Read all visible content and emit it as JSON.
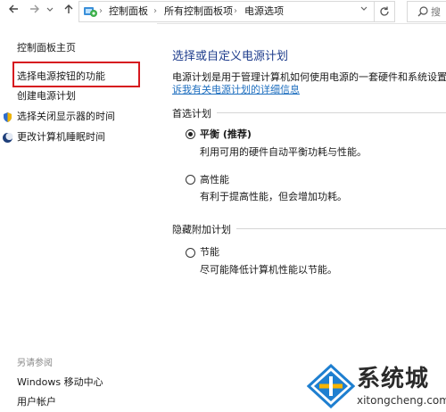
{
  "address_bar": {
    "crumbs": [
      "控制面板",
      "所有控制面板项",
      "电源选项"
    ],
    "search_placeholder": "搜"
  },
  "icons": {
    "back": "back-arrow-icon",
    "forward": "forward-arrow-icon",
    "recent": "chevron-down-icon",
    "up": "up-arrow-icon",
    "control_panel": "control-panel-icon",
    "refresh": "refresh-icon",
    "search": "search-icon",
    "shield": "uac-shield-icon",
    "moon": "sleep-moon-icon"
  },
  "sidebar": {
    "home": "控制面板主页",
    "items": [
      {
        "label": "选择电源按钮的功能",
        "highlighted": true
      },
      {
        "label": "创建电源计划"
      },
      {
        "label": "选择关闭显示器的时间",
        "icon": "uac-shield-icon"
      },
      {
        "label": "更改计算机睡眠时间",
        "icon": "sleep-moon-icon"
      }
    ],
    "see_also_title": "另请参阅",
    "see_also": [
      "Windows 移动中心",
      "用户帐户"
    ]
  },
  "main": {
    "title": "选择或自定义电源计划",
    "description": "电源计划是用于管理计算机如何使用电源的一套硬件和系统设置(",
    "more_link": "诉我有关电源计划的详细信息",
    "preferred_label": "首选计划",
    "hidden_label": "隐藏附加计划",
    "plans": [
      {
        "name": "平衡 (推荐)",
        "desc": "利用可用的硬件自动平衡功耗与性能。",
        "selected": true
      },
      {
        "name": "高性能",
        "desc": "有利于提高性能，但会增加功耗。",
        "selected": false
      },
      {
        "name": "节能",
        "desc": "尽可能降低计算机性能以节能。",
        "selected": false
      }
    ]
  },
  "watermark": {
    "text": "系统城",
    "url": "xitongcheng.com"
  },
  "colors": {
    "title_blue": "#1e3c8c",
    "link_blue": "#1f6fbf",
    "highlight_red": "#d6181f"
  }
}
